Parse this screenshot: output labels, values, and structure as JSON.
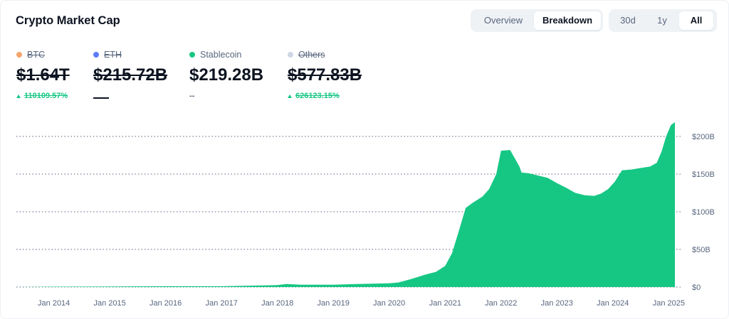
{
  "header": {
    "title": "Crypto Market Cap"
  },
  "view_toggle": {
    "overview": "Overview",
    "breakdown": "Breakdown",
    "selected": "Breakdown"
  },
  "range_toggle": {
    "d30": "30d",
    "y1": "1y",
    "all": "All",
    "selected": "All"
  },
  "legend": [
    {
      "name": "BTC",
      "color": "#f7a56b",
      "value": "$1.64T",
      "change": "110109.57%",
      "change_dir": "up",
      "disabled": true
    },
    {
      "name": "ETH",
      "color": "#5b7cfa",
      "value": "$215.72B",
      "change": "—",
      "change_dir": "none",
      "disabled": true
    },
    {
      "name": "Stablecoin",
      "color": "#16c784",
      "value": "$219.28B",
      "change": "--",
      "change_dir": "none",
      "disabled": false
    },
    {
      "name": "Others",
      "color": "#cfd6e4",
      "value": "$577.83B",
      "change": "626123.15%",
      "change_dir": "up",
      "disabled": true
    }
  ],
  "colors": {
    "area": "#16c784",
    "grid": "#58667e",
    "axis_text": "#58667e"
  },
  "chart_data": {
    "type": "area",
    "series": [
      {
        "name": "Stablecoin",
        "x": [
          "2013-05-01",
          "2014-01-01",
          "2015-01-01",
          "2016-01-01",
          "2017-01-01",
          "2017-09-01",
          "2018-01-01",
          "2018-03-01",
          "2018-06-01",
          "2019-01-01",
          "2019-06-01",
          "2020-01-01",
          "2020-03-01",
          "2020-06-01",
          "2020-09-01",
          "2020-11-01",
          "2021-01-01",
          "2021-02-15",
          "2021-04-01",
          "2021-05-15",
          "2021-07-01",
          "2021-09-01",
          "2021-10-15",
          "2021-12-01",
          "2022-01-01",
          "2022-03-01",
          "2022-05-01",
          "2022-05-15",
          "2022-07-01",
          "2022-09-01",
          "2022-11-01",
          "2023-01-01",
          "2023-03-01",
          "2023-05-01",
          "2023-07-01",
          "2023-09-01",
          "2023-10-15",
          "2023-12-01",
          "2024-01-15",
          "2024-03-01",
          "2024-05-01",
          "2024-07-01",
          "2024-09-01",
          "2024-10-15",
          "2024-11-15",
          "2024-12-15",
          "2025-01-15",
          "2025-02-10"
        ],
        "y": [
          0,
          0.5,
          0.7,
          1,
          1,
          2,
          2.5,
          4,
          3,
          3,
          4,
          5,
          6,
          11,
          17,
          20,
          28,
          45,
          75,
          105,
          112,
          120,
          130,
          150,
          181,
          182,
          160,
          152,
          151,
          148,
          145,
          138,
          132,
          125,
          122,
          121,
          124,
          130,
          140,
          155,
          156,
          158,
          160,
          165,
          180,
          200,
          215,
          219
        ]
      }
    ],
    "x_ticks": [
      "Jan 2014",
      "Jan 2015",
      "Jan 2016",
      "Jan 2017",
      "Jan 2018",
      "Jan 2019",
      "Jan 2020",
      "Jan 2021",
      "Jan 2022",
      "Jan 2023",
      "Jan 2024",
      "Jan 2025"
    ],
    "y_ticks": [
      "$0",
      "$50B",
      "$100B",
      "$150B",
      "$200B"
    ],
    "y_tick_values": [
      0,
      50,
      100,
      150,
      200
    ],
    "ylim": [
      0,
      200
    ],
    "xlim": [
      "2013-05-01",
      "2025-02-10"
    ],
    "grid": true,
    "legend_position": "top-left"
  }
}
